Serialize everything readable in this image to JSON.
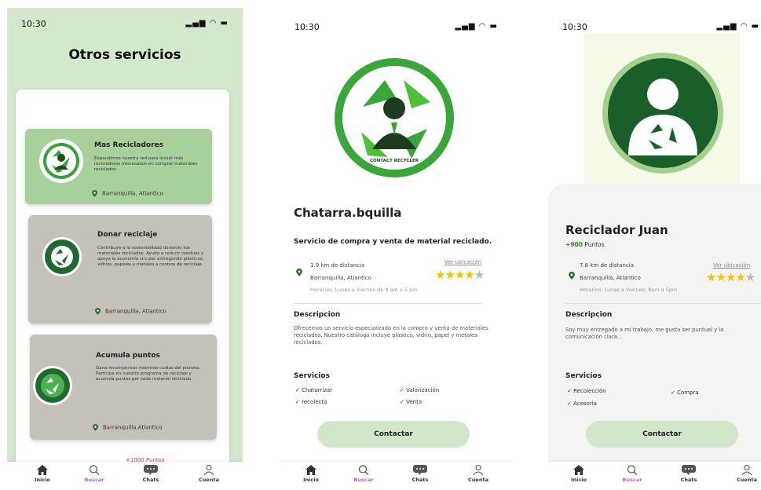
{
  "status": {
    "time": "10:30",
    "signal_icons": "signal-wifi-battery"
  },
  "colors": {
    "accent": "#a86ad6",
    "primary_green": "#2e8b2e",
    "light_green": "#d4e8cd",
    "star": "#f2c200"
  },
  "screen1": {
    "title": "Otros servicios",
    "cards": [
      {
        "title": "Mas Recicladores",
        "desc": "Expandimos nuestra red para incluir más recicladores interesados en comprar materiales reciclados.",
        "location": "Barranquilla, Atlantico"
      },
      {
        "title": "Donar reciclaje",
        "desc": "Contribuye a la sostenibilidad donando tus materiales reciclados. Ayuda a reducir residuos y apoya la economía circular entregando plásticos, vidrios, papeles y metales a centros de reciclaje.",
        "location": "Barranquilla, Atlantico"
      },
      {
        "title": "Acumula puntos",
        "desc": "Gana recompensas mientras cuidas del planeta. Participa en nuestro programa de reciclaje y acumula puntos por cada material reciclado.",
        "location": "Barranquilla,Atlantico"
      }
    ],
    "peek_text": "+1000 Puntos"
  },
  "nav": {
    "items": [
      "Inicio",
      "Buscar",
      "Chats",
      "Cuenta"
    ],
    "active": "Buscar"
  },
  "screen2": {
    "logo_text": "CONTACT RECYCLER",
    "name": "Chatarra.bquilla",
    "tagline": "Servicio de compra y venta de material reciclado.",
    "distance": "1.9 km de distancia",
    "location": "Barranquilla, Atlantico",
    "hours": "Horarios: Lunes a Viernes de 8 am a 5 pm",
    "link": "Ver ubicación",
    "rating": 4,
    "desc_title": "Descripcion",
    "desc": "Ofrecemos un servicio especializado en la compra y venta de materiales reciclados. Nuestro catálogo incluye plástico, vidrio, papel y metales reciclados.",
    "services_title": "Servicios",
    "services": [
      "Chatarrizar",
      "Valorización",
      "recolecta",
      "Venta"
    ],
    "button": "Contactar"
  },
  "screen3": {
    "name": "Reciclador Juan",
    "points_value": "+900",
    "points_label": "Puntos",
    "distance": "7.8 km de distancia",
    "location": "Barranquilla, Atlantico",
    "hours": "Horarios: Lunes a Viernes, 8am a 5pm",
    "link": "Ver ubicación",
    "rating": 4,
    "desc_title": "Descripcion",
    "desc": "Soy muy entregado a mi trabajo, me gusta ser puntual y la comunicación clara...",
    "services_title": "Servicios",
    "services": [
      "Recolección",
      "Compra",
      "Acesoria"
    ],
    "button": "Contactar"
  }
}
